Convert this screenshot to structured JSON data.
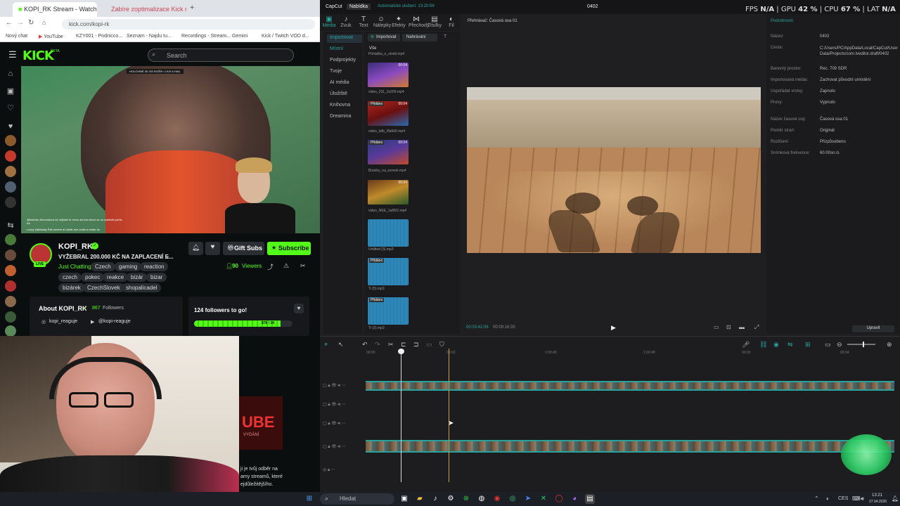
{
  "browser": {
    "tabs": [
      {
        "label": "KOPI_RK Stream - Watch Live on Kick",
        "active": true
      },
      {
        "label": "Zabíre zoptimalizace Kick na...",
        "active": false
      }
    ],
    "new_tab_label": "+",
    "address": "kick.com/kopi-rk",
    "bookmarks": [
      "Nový chat",
      "YouTube",
      "KZY001 - Podnicco...",
      "Seznam - Najdu tu...",
      "Recordings - Stream...",
      "Gemini",
      "Kick / Twitch VOD d..."
    ]
  },
  "kick": {
    "logo": "KICK",
    "logo_badge": "BETA",
    "search_placeholder": "Search",
    "overlay_text": "HOLOVINÉ 30 202 BOŽÍH / LIVE A HAIL",
    "chat_overlay": "@bazeke zboruzstcus Až zříjasle to mevo ani ido snbut ve na vydabila portiu na",
    "chat_overlay2": "Lozzy Zatbinsky Pak koneré al Usktit aon ondle a budte du",
    "channel_name": "KOPI_RK",
    "live_badge": "LIVE",
    "stream_title": "VYŽEBRAL 200.000 KČ NA ZAPLACENÍ E...",
    "category": "Just Chatting",
    "tags": [
      "Czech",
      "gaming",
      "reaction",
      "czech",
      "pokec",
      "reakce",
      "bizár",
      "bizar",
      "bizárek",
      "CzechSlovek",
      "shopalicadel"
    ],
    "gift_subs": "Gift Subs",
    "subscribe": "Subscribe",
    "viewers_count": "90",
    "viewers_label": "Viewers",
    "about_title": "About KOPI_RK",
    "followers_count": "867",
    "followers_label": "Followers",
    "social1": "kopi_reaguje",
    "social2": "@kopi-reaguje",
    "goal_title": "124 followers to go!",
    "goal_progress": "876 / 1K",
    "goal_fraction": 0.876,
    "below_banner": "UBE",
    "below_banner_sub": "VYDÁNÍ",
    "below_text1": "ji je tvůj odběr na",
    "below_text2": "amy streamů, které",
    "below_text3": "ejdůležitějšího."
  },
  "capcut": {
    "app_name": "CapCut",
    "menu": "Nabídka",
    "autosave": "Automatické uložení: 13:20:58",
    "project_title": "0402",
    "tools": [
      {
        "icon": "▣",
        "label": "Média"
      },
      {
        "icon": "♪",
        "label": "Zvuk"
      },
      {
        "icon": "T",
        "label": "Text"
      },
      {
        "icon": "☺",
        "label": "Nálepky"
      },
      {
        "icon": "✦",
        "label": "Efekty"
      },
      {
        "icon": "⋈",
        "label": "Přechody"
      },
      {
        "icon": "▤",
        "label": "Titulky"
      },
      {
        "icon": "◐",
        "label": "Fil"
      }
    ],
    "left_nav": [
      "Importovat",
      "Místní",
      "Podprojekty",
      "Tvoje",
      "AI média",
      "Úložiště",
      "Knihovna",
      "Dreamina"
    ],
    "import_btn": "Importovat",
    "sort_btn": "Nahrávání",
    "all_label": "Vše",
    "media_items": [
      {
        "name": "Pohádka_o_straši.mp4",
        "duration": "00:04",
        "added": ""
      },
      {
        "name": "video_231_2s209.mp4",
        "duration": "00:04",
        "added": "Přidáno"
      },
      {
        "name": "video_lafb_3fa6d0.mp4",
        "duration": "00:04",
        "added": "Přidáno"
      },
      {
        "name": "Bizárky_na_ezreek.mp4",
        "duration": "00:04",
        "added": ""
      },
      {
        "name": "video_NEE_1a6f02.mp4",
        "duration": "",
        "added": ""
      },
      {
        "name": "Untitled (3).mp3",
        "duration": "",
        "added": "Přidáno"
      },
      {
        "name": "Ti (5).mp3",
        "duration": "",
        "added": "Přidáno"
      },
      {
        "name": "Ti (2).mp3",
        "duration": "",
        "added": ""
      }
    ],
    "player_title": "Přehrávač: Časová osa 01",
    "time_current": "00:03:42:06",
    "time_total": "00:09:16:35",
    "props_title": "Podrobnosti",
    "props": [
      {
        "label": "Název:",
        "value": "0402"
      },
      {
        "label": "Cesta:",
        "value": "C:/Users/PC/AppData/Local/CapCut/User Data/Projects/com.lveditor.draft/0402"
      },
      {
        "label": "Barevný prostor:",
        "value": "Rec. 709 SDR"
      },
      {
        "label": "Importovaná média:",
        "value": "Zachovat původní umístění"
      },
      {
        "label": "Uspořádat vrstvy:",
        "value": "Zapnuto"
      },
      {
        "label": "Proxy:",
        "value": "Vypnuto"
      },
      {
        "label": "Název časové osy:",
        "value": "Časová osa 01"
      },
      {
        "label": "Poměr stran:",
        "value": "Originál"
      },
      {
        "label": "Rozlišení:",
        "value": "Přizpůsobeno"
      },
      {
        "label": "Snímková frekvence:",
        "value": "60.00sn./s"
      }
    ],
    "edit_btn": "Upravit",
    "timeline_marks": [
      "00:00",
      "00:02",
      "1:00:45",
      "1:00:48",
      "00:02",
      "00:04"
    ]
  },
  "hud": {
    "fps_label": "FPS",
    "fps": "N/A",
    "gpu_label": "GPU",
    "gpu": "42 %",
    "cpu_label": "CPU",
    "cpu": "67 %",
    "lat_label": "LAT",
    "lat": "N/A"
  },
  "taskbar": {
    "search_placeholder": "Hledat",
    "lang": "CES",
    "time": "13:21",
    "date": "27.04.2026"
  },
  "colors": {
    "kick_green": "#53fc18",
    "capcut_accent": "#2aa39c"
  }
}
